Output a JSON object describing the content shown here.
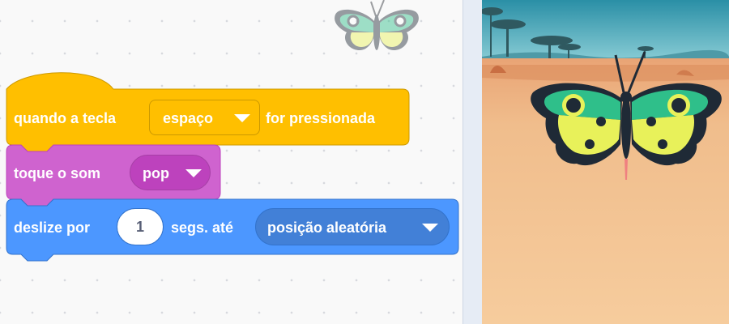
{
  "workspace": {
    "hat_block": {
      "prefix": "quando a tecla",
      "key_dropdown": "espaço",
      "suffix": "for pressionada",
      "color": "#FFBF00"
    },
    "sound_block": {
      "prefix": "toque o som",
      "sound_dropdown": "pop",
      "color": "#CF63CF"
    },
    "glide_block": {
      "prefix": "deslize por",
      "seconds_input": "1",
      "middle": "segs. até",
      "target_dropdown": "posição aleatória",
      "color": "#4C97FF"
    },
    "sprite_watermark_icon": "butterfly-icon"
  },
  "stage": {
    "backdrop": "savanna",
    "sprite_icon": "butterfly-icon",
    "sky_color": "#2f9bb0",
    "ground_color": "#f2c595"
  }
}
